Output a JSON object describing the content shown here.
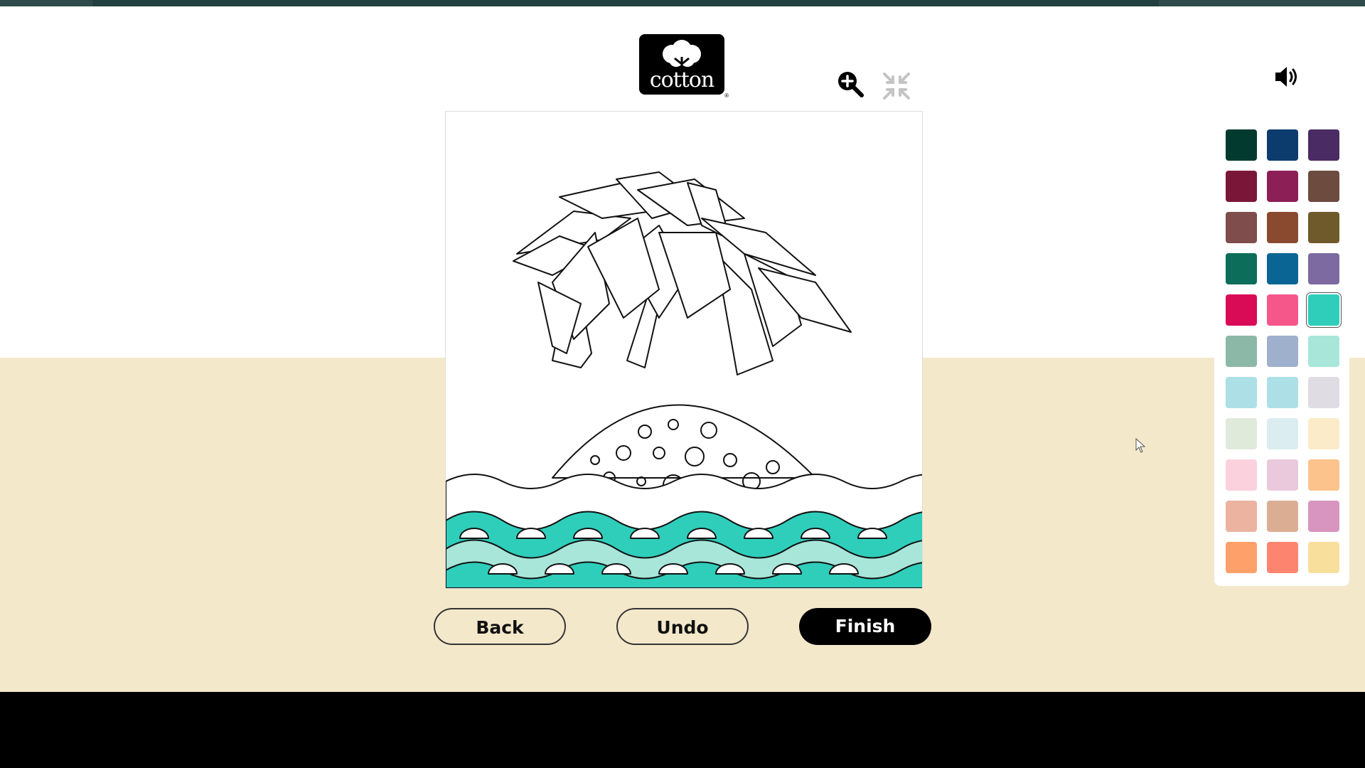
{
  "header": {
    "logo_text": "cotton",
    "logo_mark": "®"
  },
  "toolbar": {
    "zoom_icon": "zoom-in-icon",
    "minimize_icon": "minimize-icon",
    "sound_icon": "speaker-icon"
  },
  "palette": {
    "colors": [
      "#033a30",
      "#0c3c6e",
      "#4a2b64",
      "#7a1738",
      "#8c1f56",
      "#6e4b3f",
      "#7e4d4c",
      "#8a4a30",
      "#6e5a2a",
      "#0c6d5a",
      "#0b6594",
      "#7d6aa0",
      "#d90b57",
      "#f5578b",
      "#2fcebb",
      "#8cb8a7",
      "#9fb0cd",
      "#a8e6da",
      "#ace0e6",
      "#ace0e6",
      "#dfdce4",
      "#e0eadb",
      "#dbedf0",
      "#fbebc8",
      "#fbd1dd",
      "#eac9dc",
      "#fdc38c",
      "#ebb3a0",
      "#dbae94",
      "#d895bf",
      "#fda06a",
      "#fd856f",
      "#f8df9c"
    ],
    "selected_index": 14
  },
  "buttons": {
    "back_label": "Back",
    "undo_label": "Undo",
    "finish_label": "Finish"
  }
}
